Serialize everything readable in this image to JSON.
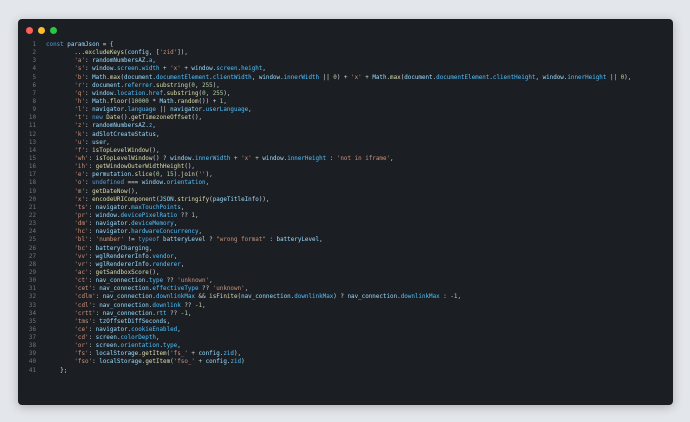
{
  "window": {
    "title_dots": [
      "close",
      "minimize",
      "maximize"
    ],
    "colors": {
      "background": "#1b1f24",
      "close": "#ff5f57",
      "minimize": "#febc2e",
      "maximize": "#28c840"
    }
  },
  "editor": {
    "language": "javascript",
    "lines": [
      "const paramJson = {",
      "        ...excludeKeys(config, ['zid']),",
      "        'a': randomNumbersAZ.a,",
      "        's': window.screen.width + 'x' + window.screen.height,",
      "        'b': Math.max(document.documentElement.clientWidth, window.innerWidth || 0) + 'x' + Math.max(document.documentElement.clientHeight, window.innerHeight || 0),",
      "        'r': document.referrer.substring(0, 255),",
      "        'q': window.location.href.substring(0, 255),",
      "        'h': Math.floor(10000 * Math.random()) + 1,",
      "        'l': navigator.language || navigator.userLanguage,",
      "        't': new Date().getTimezoneOffset(),",
      "        'z': randomNumbersAZ.z,",
      "        'k': adSlotCreateStatus,",
      "        'u': user,",
      "        'f': isTopLevelWindow(),",
      "        'wh': isTopLevelWindow() ? window.innerWidth + 'x' + window.innerHeight : 'not in iframe',",
      "        'ih': getWindowOuterWidthHeight(),",
      "        'e': permutation.slice(0, 15).join(''),",
      "        'o': undefined === window.orientation,",
      "        'm': getDateNow(),",
      "        'x': encodeURIComponent(JSON.stringify(pageTitleInfo)),",
      "        'ts': navigator.maxTouchPoints,",
      "        'pr': window.devicePixelRatio ?? 1,",
      "        'dm': navigator.deviceMemory,",
      "        'hc': navigator.hardwareConcurrency,",
      "        'bl': 'number' != typeof batteryLevel ? \"wrong format\" : batteryLevel,",
      "        'bc': batteryCharging,",
      "        'vv': wglRendererInfo.vendor,",
      "        'vr': wglRendererInfo.renderer,",
      "        'ac': getSandboxScore(),",
      "        'ct': nav_connection.type ?? 'unknown',",
      "        'cet': nav_connection.effectiveType ?? 'unknown',",
      "        'cdlm': nav_connection.downlinkMax && isFinite(nav_connection.downlinkMax) ? nav_connection.downlinkMax : -1,",
      "        'cdl': nav_connection.downlink ?? -1,",
      "        'crtt': nav_connection.rtt ?? -1,",
      "        'tms': tzOffsetDiffSeconds,",
      "        'ce': navigator.cookieEnabled,",
      "        'cd': screen.colorDepth,",
      "        'or': screen.orientation.type,",
      "        'fs': localStorage.getItem('fs_' + config.zid),",
      "        'fso': localStorage.getItem('fso_' + config.zid)",
      "    };"
    ]
  }
}
